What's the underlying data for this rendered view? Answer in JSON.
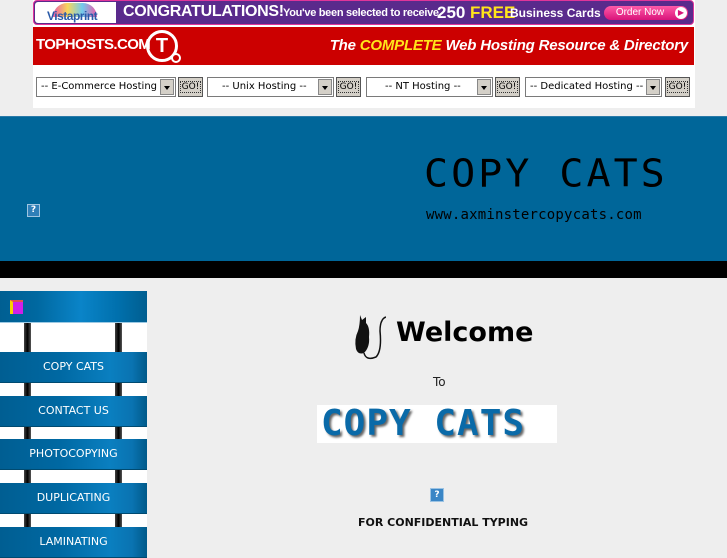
{
  "ad_banner": {
    "vistaprint_logo": "Vistaprint",
    "headline": "CONGRATULATIONS!",
    "subtext": "You've been selected to receive",
    "quantity": "250",
    "free": "FREE",
    "product": "Business Cards",
    "cta": "Order Now",
    "cta_icon": "play-arrow-icon"
  },
  "tophosts": {
    "brand": "TOPHOSTS.COM",
    "logo_letter": "T",
    "tagline_prefix": "The ",
    "tagline_highlight": "COMPLETE",
    "tagline_suffix": " Web Hosting Resource & Directory"
  },
  "hosting_selects": [
    {
      "selected": "-- E-Commerce Hosting --",
      "go_label": "GO!"
    },
    {
      "selected": "-- Unix Hosting --",
      "go_label": "GO!"
    },
    {
      "selected": "-- NT Hosting --",
      "go_label": "GO!"
    },
    {
      "selected": "-- Dedicated Hosting --",
      "go_label": "GO!"
    }
  ],
  "header": {
    "broken_image_glyph": "?",
    "title": "COPY CATS",
    "url": "www.axminstercopycats.com"
  },
  "sidebar": {
    "items": [
      {
        "label": "COPY CATS"
      },
      {
        "label": "CONTACT US"
      },
      {
        "label": "PHOTOCOPYING"
      },
      {
        "label": "DUPLICATING"
      },
      {
        "label": "LAMINATING"
      }
    ]
  },
  "main": {
    "welcome": "Welcome",
    "to": "To",
    "logo_text": "COPY CATS",
    "broken_image_glyph": "?",
    "tagline": "FOR CONFIDENTIAL TYPING"
  },
  "colors": {
    "header_bg": "#006699",
    "tophosts_red": "#cc0000",
    "vistaprint_purple": "#5a2a8c",
    "page_bg": "#eeeeee"
  }
}
